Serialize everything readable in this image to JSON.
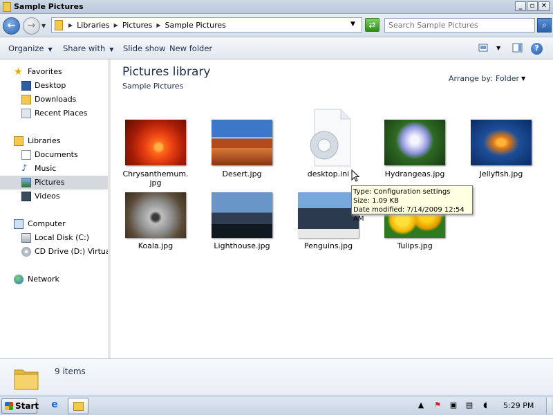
{
  "window": {
    "title": "Sample Pictures"
  },
  "address": {
    "crumbs": [
      "Libraries",
      "Pictures",
      "Sample Pictures"
    ],
    "search_placeholder": "Search Sample Pictures"
  },
  "toolbar": {
    "organize": "Organize",
    "share_with": "Share with",
    "slide_show": "Slide show",
    "new_folder": "New folder"
  },
  "sidebar": {
    "favorites": {
      "label": "Favorites",
      "items": [
        "Desktop",
        "Downloads",
        "Recent Places"
      ]
    },
    "libraries": {
      "label": "Libraries",
      "items": [
        "Documents",
        "Music",
        "Pictures",
        "Videos"
      ],
      "selected": "Pictures"
    },
    "computer": {
      "label": "Computer",
      "items": [
        "Local Disk (C:)",
        "CD Drive (D:) VirtualBo"
      ]
    },
    "network": {
      "label": "Network"
    }
  },
  "content": {
    "title": "Pictures library",
    "subtitle": "Sample Pictures",
    "arrange_label": "Arrange by:",
    "arrange_value": "Folder",
    "files": [
      {
        "name": "Chrysanthemum.jpg"
      },
      {
        "name": "Desert.jpg"
      },
      {
        "name": "desktop.ini"
      },
      {
        "name": "Hydrangeas.jpg"
      },
      {
        "name": "Jellyfish.jpg"
      },
      {
        "name": "Koala.jpg"
      },
      {
        "name": "Lighthouse.jpg"
      },
      {
        "name": "Penguins.jpg"
      },
      {
        "name": "Tulips.jpg"
      }
    ]
  },
  "tooltip": {
    "type": "Type: Configuration settings",
    "size": "Size: 1.09 KB",
    "modified": "Date modified: 7/14/2009 12:54 AM"
  },
  "details": {
    "count": "9 items"
  },
  "taskbar": {
    "start": "Start",
    "clock": "5:29 PM"
  },
  "colors": {
    "accent": "#1e3050",
    "selected_nav": "#d5d9de",
    "tooltip_bg": "#ffffe1"
  }
}
